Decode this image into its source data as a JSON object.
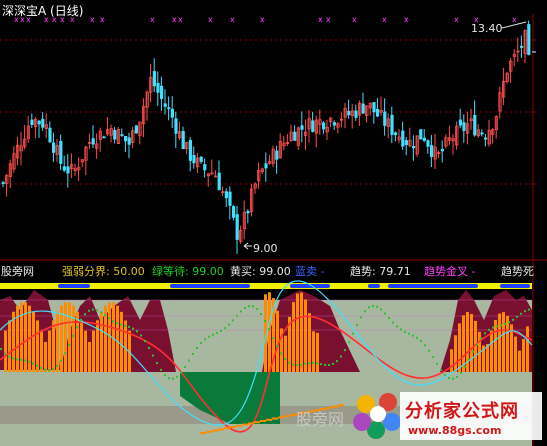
{
  "header": {
    "title": "深深宝A (日线)"
  },
  "price_labels": {
    "high": "13.40",
    "low": "9.00"
  },
  "indicator": {
    "name": "股旁网",
    "items": [
      {
        "label": "强弱分界: 50.00",
        "color": "gold"
      },
      {
        "label": "绿等待: 99.00",
        "color": "green"
      },
      {
        "label": "黄买: 99.00",
        "color": "white"
      },
      {
        "label": "蓝卖 -",
        "color": "blue"
      },
      {
        "label": "趋势: 79.71",
        "color": "white"
      },
      {
        "label": "趋势金叉 -",
        "color": "mag"
      },
      {
        "label": "趋势死",
        "color": "white"
      }
    ]
  },
  "watermark": {
    "brand": "分析家公式网",
    "url": "www.88gs.com",
    "site": "股旁网"
  },
  "colors": {
    "up": "#ff4d4d",
    "down": "#40e0ff",
    "grid": "#8b0000",
    "maroon": "#7a1030",
    "green_band": "#0a7a3a",
    "gray_band": "#a8b8a0",
    "yellow": "#f0f000",
    "blue": "#2040ff",
    "orange": "#ff8c00"
  },
  "chart_data": {
    "type": "candlestick",
    "title": "深深宝A (日线)",
    "ylim": [
      8.8,
      13.7
    ],
    "high_mark": 13.4,
    "low_mark": 9.0
  }
}
